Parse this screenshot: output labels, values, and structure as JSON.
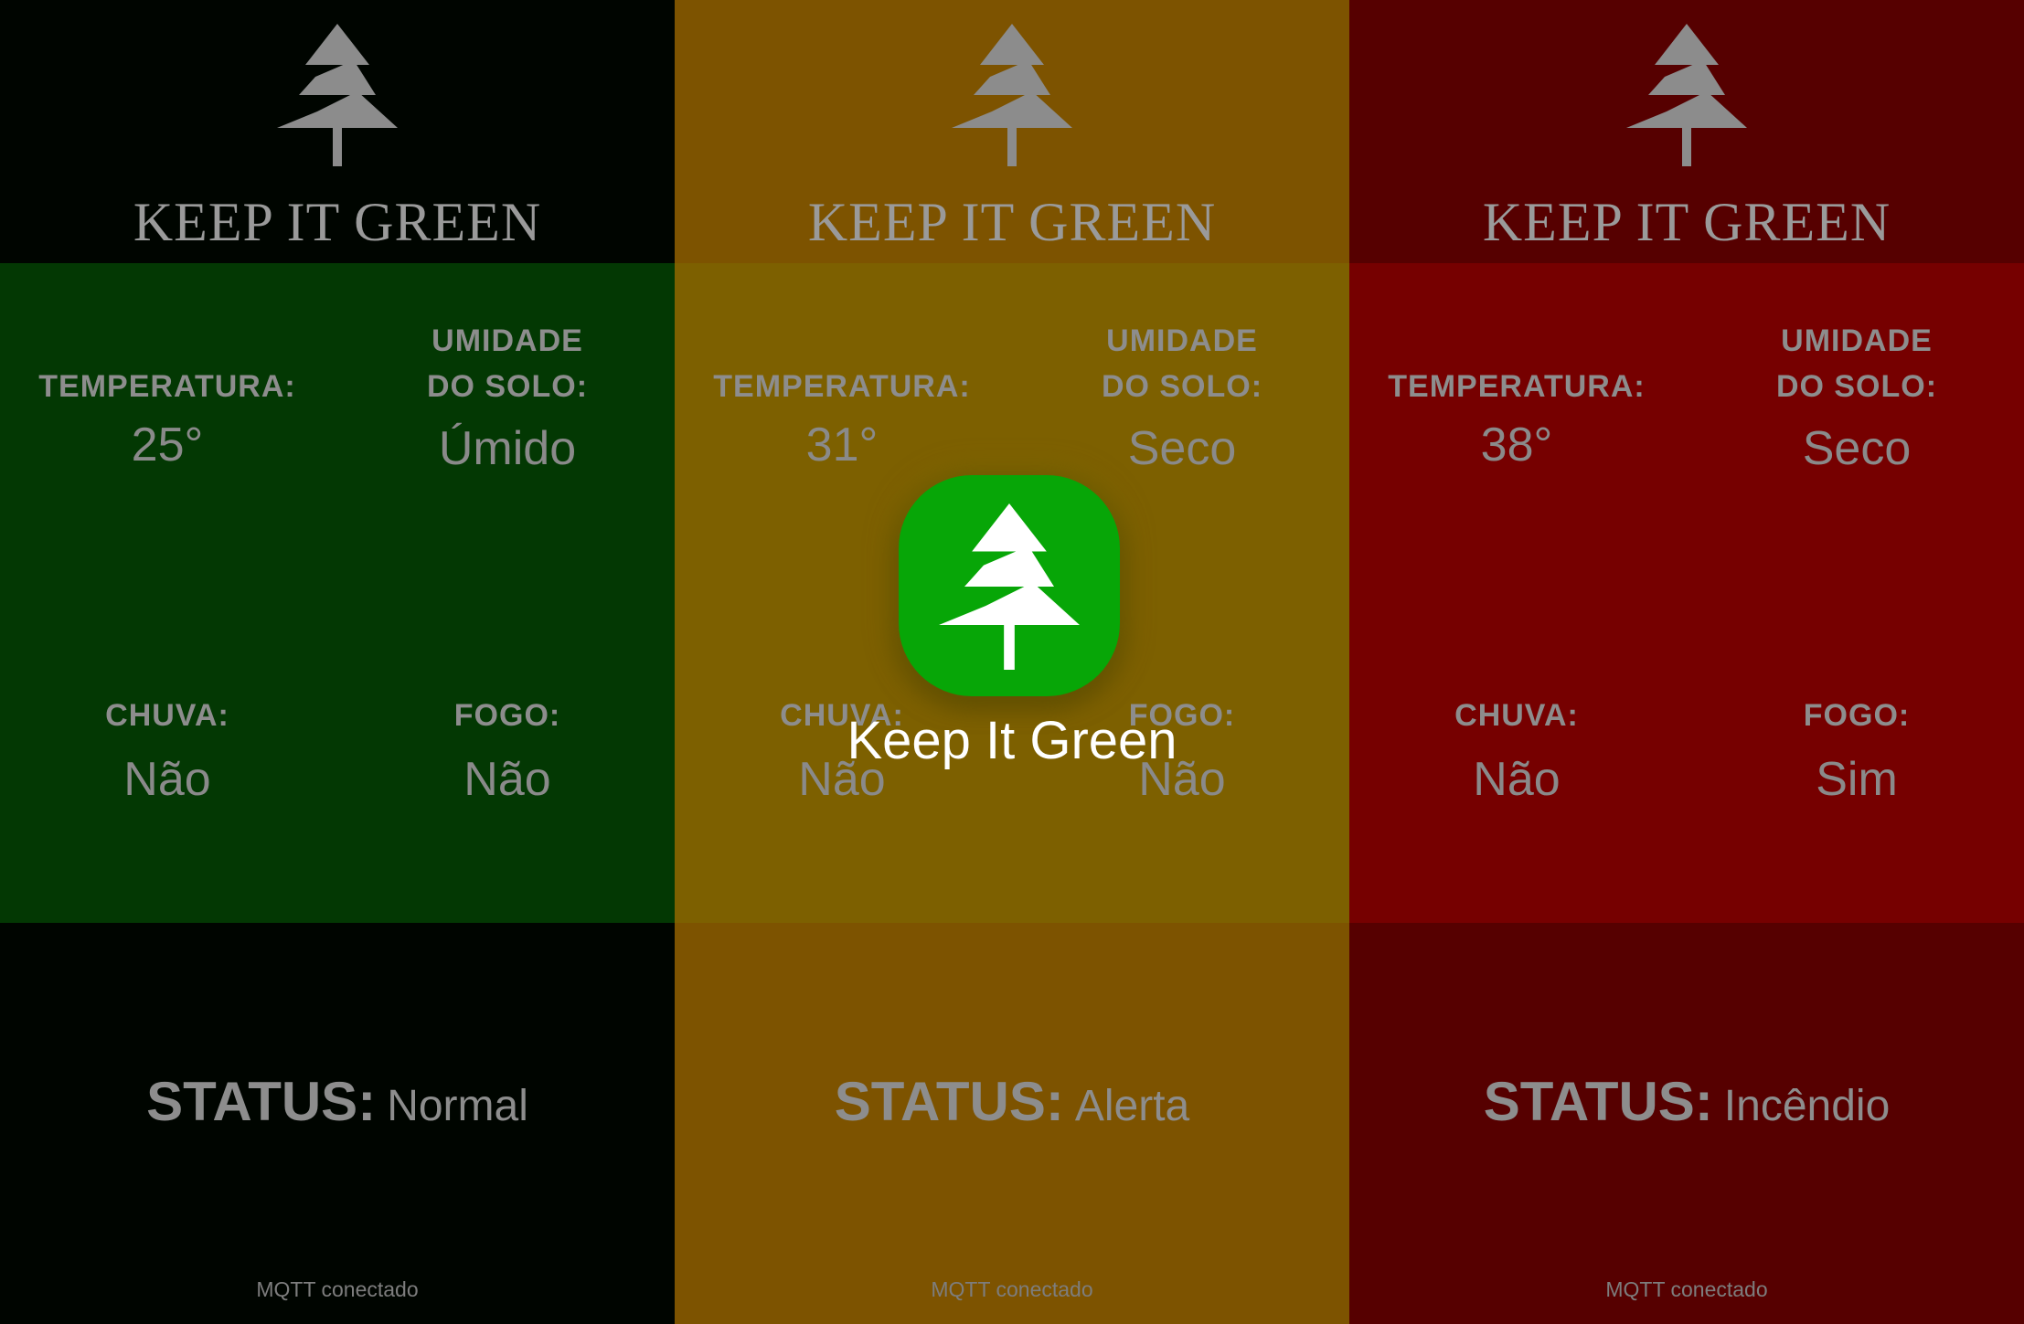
{
  "splash": {
    "app_name": "Keep It Green",
    "icon": "tree-icon",
    "icon_color": "#07a607"
  },
  "labels": {
    "temperature": "TEMPERATURA:",
    "soil_humidity": "UMIDADE DO SOLO:",
    "rain": "CHUVA:",
    "fire": "FOGO:",
    "status": "STATUS:"
  },
  "panels": [
    {
      "brand": "KEEP IT GREEN",
      "temperature": "25°",
      "soil": "Úmido",
      "rain": "Não",
      "fire": "Não",
      "status": "Normal",
      "connection": "MQTT conectado",
      "accent": "#033803"
    },
    {
      "brand": "KEEP IT GREEN",
      "temperature": "31°",
      "soil": "Seco",
      "rain": "Não",
      "fire": "Não",
      "status": "Alerta",
      "connection": "MQTT conectado",
      "accent": "#7d6000"
    },
    {
      "brand": "KEEP IT GREEN",
      "temperature": "38°",
      "soil": "Seco",
      "rain": "Não",
      "fire": "Sim",
      "status": "Incêndio",
      "connection": "MQTT conectado",
      "accent": "#760000"
    }
  ]
}
